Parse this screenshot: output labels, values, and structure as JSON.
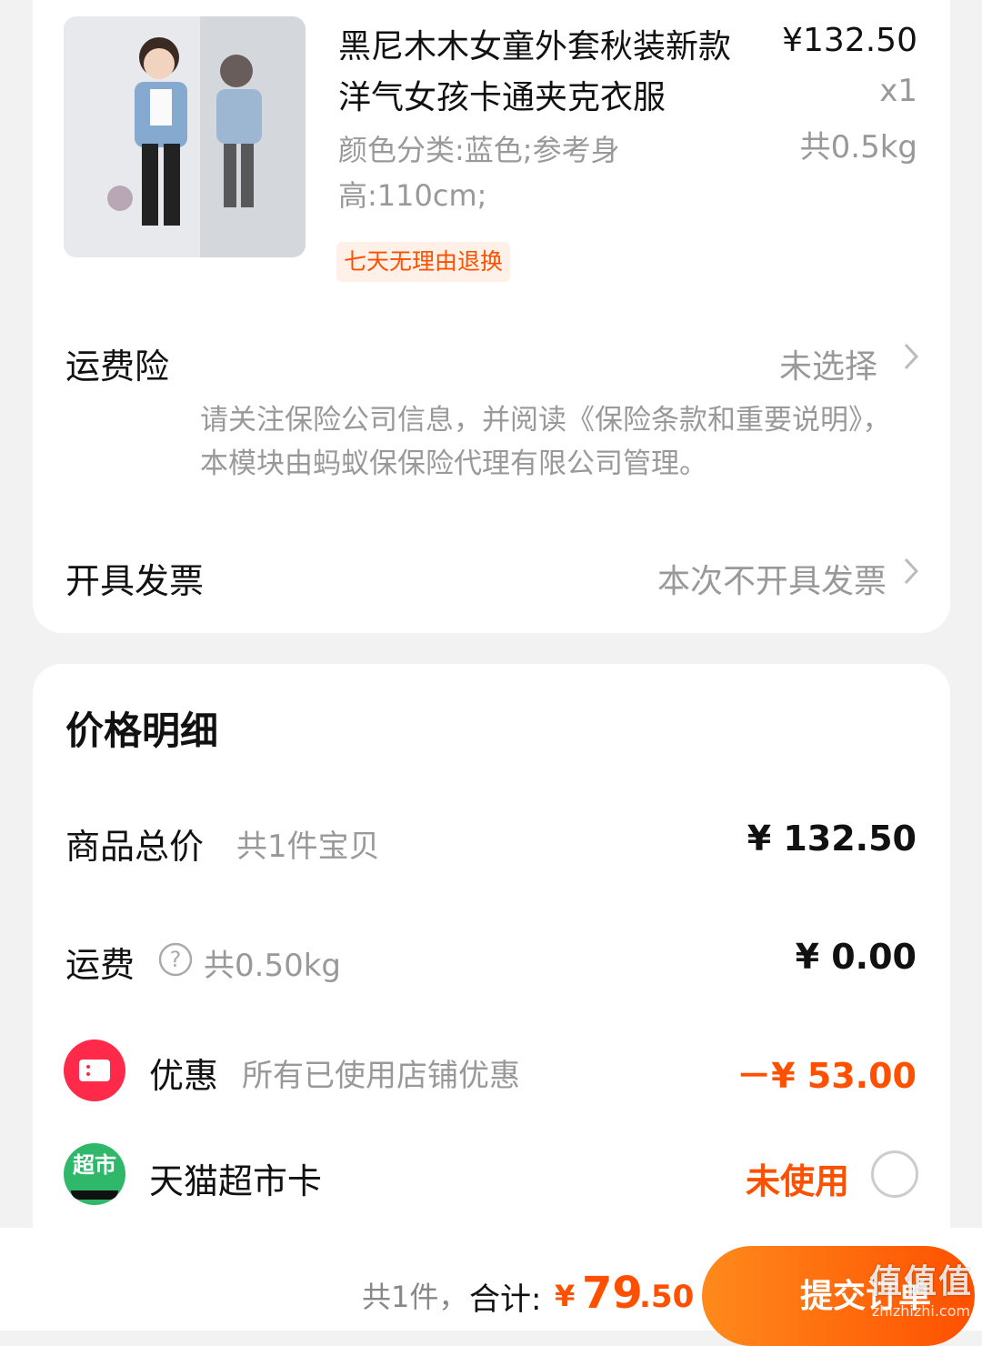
{
  "product": {
    "title": "黑尼木木女童外套秋装新款洋气女孩卡通夹克衣服",
    "price": "¥132.50",
    "quantity": "x1",
    "weight": "共0.5kg",
    "sku": "颜色分类:蓝色;参考身高:110cm;",
    "tag": "七天无理由退换"
  },
  "shipping_insurance": {
    "label": "运费险",
    "value": "未选择",
    "description": "请关注保险公司信息，并阅读《保险条款和重要说明》，本模块由蚂蚁保保险代理有限公司管理。"
  },
  "invoice": {
    "label": "开具发票",
    "value": "本次不开具发票"
  },
  "price_detail": {
    "title": "价格明细",
    "goods_total_label": "商品总价",
    "goods_total_sub": "共1件宝贝",
    "goods_total_amount": "¥ 132.50",
    "freight_label": "运费",
    "freight_sub": "共0.50kg",
    "freight_amount": "¥ 0.00",
    "discount_label": "优惠",
    "discount_sub": "所有已使用店铺优惠",
    "discount_amount": "－¥ 53.00",
    "tmall_card_label": "天猫超市卡",
    "tmall_card_icon_text": "超市",
    "tmall_card_status": "未使用"
  },
  "footer": {
    "count_text": "共1件，",
    "total_label": "合计:",
    "currency": "¥",
    "total_integer": "79",
    "total_decimal": ".50",
    "submit_label": "提交订单"
  },
  "watermark": {
    "big": "值值值",
    "small": "zhizhizhi.com"
  },
  "colors": {
    "accent": "#ff5000",
    "coupon_icon": "#ff2a4a",
    "market_icon": "#2fb86a"
  }
}
